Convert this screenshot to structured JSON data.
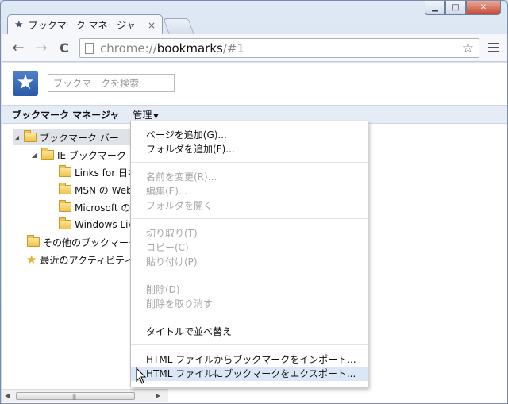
{
  "window": {
    "tab_title": "ブックマーク マネージャ",
    "tab_close": "×",
    "minimize": "▁",
    "maximize": "□",
    "close": "✕"
  },
  "toolbar": {
    "back": "←",
    "forward": "→",
    "reload": "C",
    "url_scheme": "chrome://",
    "url_host": "bookmarks",
    "url_path": "/#1",
    "star": "☆"
  },
  "header": {
    "search_placeholder": "ブックマークを検索",
    "manager_title": "ブックマーク マネージャ",
    "organize_label": "管理"
  },
  "tree": [
    {
      "label": "ブックマーク バー",
      "icon": "folder-icon",
      "twisty": "◢"
    },
    {
      "label": "IE ブックマーク",
      "icon": "folder-icon",
      "twisty": "◢"
    },
    {
      "label": "Links for 日本",
      "icon": "folder-icon"
    },
    {
      "label": "MSN の Web",
      "icon": "folder-icon"
    },
    {
      "label": "Microsoft の",
      "icon": "folder-icon"
    },
    {
      "label": "Windows Live",
      "icon": "folder-icon"
    },
    {
      "label": "その他のブックマーク",
      "icon": "folder-icon"
    },
    {
      "label": "最近のアクティビティ",
      "icon": "star-icon"
    }
  ],
  "menu": {
    "add_page": "ページを追加(G)...",
    "add_folder": "フォルダを追加(F)...",
    "rename": "名前を変更(R)...",
    "edit": "編集(E)...",
    "open_folder": "フォルダを開く",
    "cut": "切り取り(T)",
    "copy": "コピー(C)",
    "paste": "貼り付け(P)",
    "delete": "削除(D)",
    "undo_delete": "削除を取り消す",
    "sort_by_title": "タイトルで並べ替え",
    "import_html": "HTML ファイルからブックマークをインポート...",
    "export_html": "HTML ファイルにブックマークをエクスポート..."
  }
}
